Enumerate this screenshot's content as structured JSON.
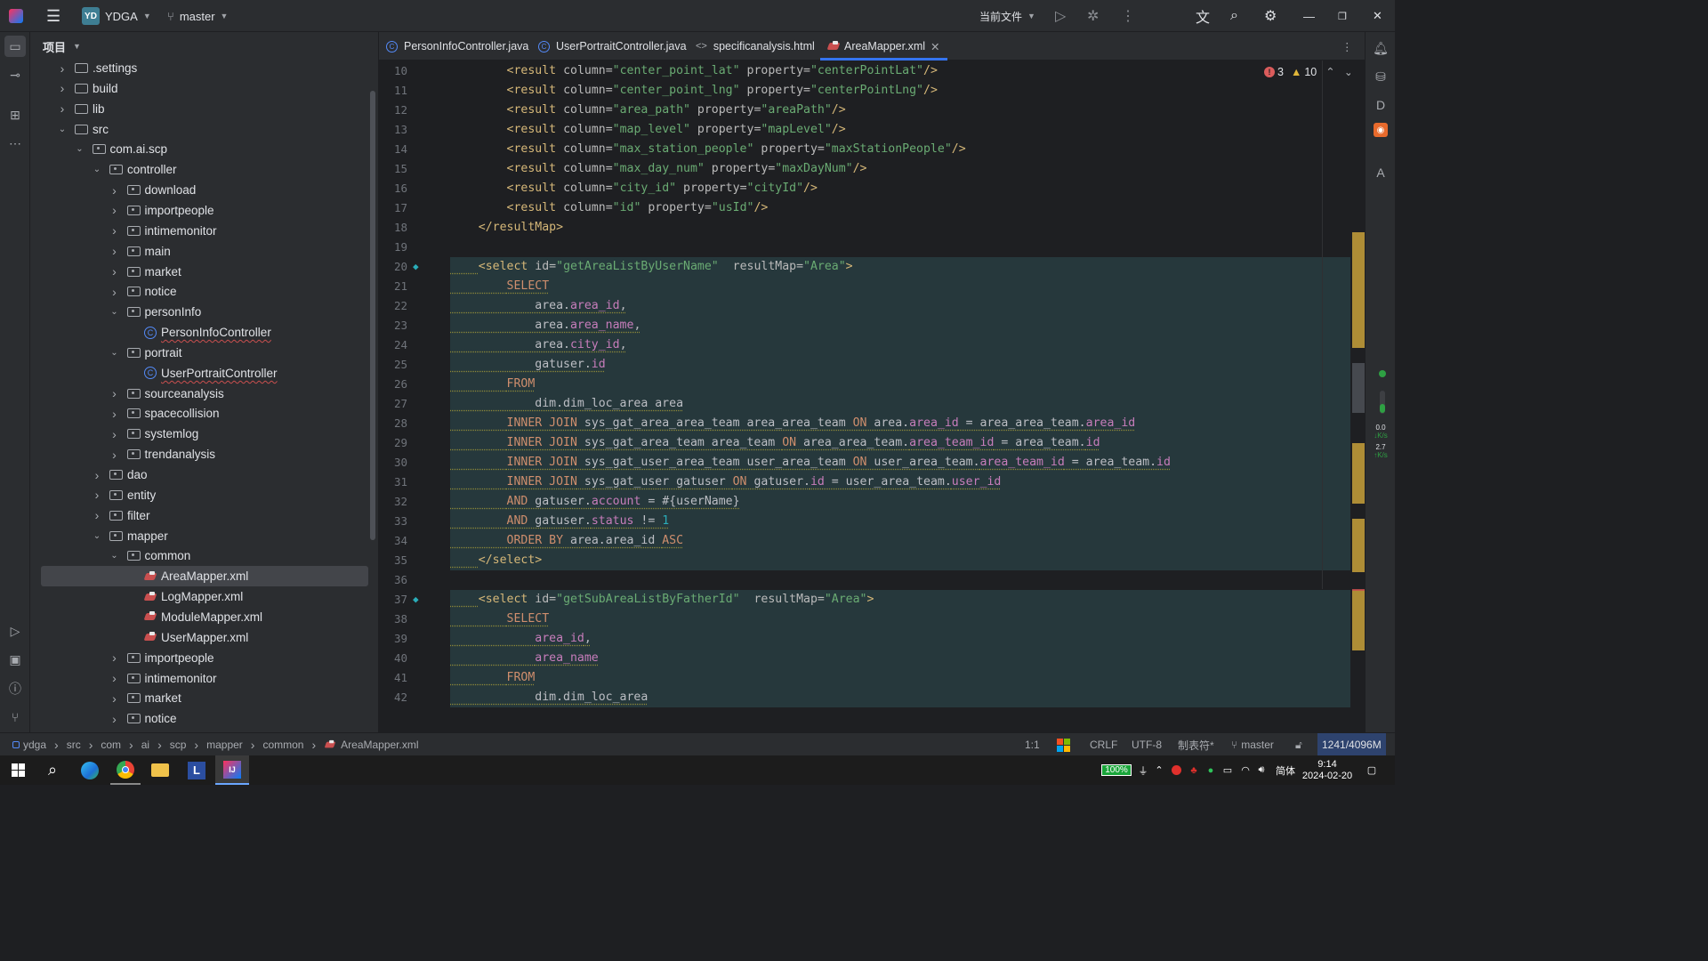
{
  "titlebar": {
    "project_badge": "YD",
    "project_name": "YDGA",
    "branch": "master",
    "run_config": "当前文件"
  },
  "sidebar": {
    "title": "项目",
    "tree": [
      {
        "label": ".settings",
        "type": "folder",
        "depth": 1,
        "expanded": false
      },
      {
        "label": "build",
        "type": "folder",
        "depth": 1,
        "expanded": false
      },
      {
        "label": "lib",
        "type": "folder",
        "depth": 1,
        "expanded": false
      },
      {
        "label": "src",
        "type": "folder",
        "depth": 1,
        "expanded": true
      },
      {
        "label": "com.ai.scp",
        "type": "package",
        "depth": 2,
        "expanded": true
      },
      {
        "label": "controller",
        "type": "package",
        "depth": 3,
        "expanded": true
      },
      {
        "label": "download",
        "type": "package",
        "depth": 4,
        "expanded": false
      },
      {
        "label": "importpeople",
        "type": "package",
        "depth": 4,
        "expanded": false
      },
      {
        "label": "intimemonitor",
        "type": "package",
        "depth": 4,
        "expanded": false
      },
      {
        "label": "main",
        "type": "package",
        "depth": 4,
        "expanded": false
      },
      {
        "label": "market",
        "type": "package",
        "depth": 4,
        "expanded": false
      },
      {
        "label": "notice",
        "type": "package",
        "depth": 4,
        "expanded": false
      },
      {
        "label": "personInfo",
        "type": "package",
        "depth": 4,
        "expanded": true
      },
      {
        "label": "PersonInfoController",
        "type": "class",
        "depth": 5,
        "expanded": null
      },
      {
        "label": "portrait",
        "type": "package",
        "depth": 4,
        "expanded": true
      },
      {
        "label": "UserPortraitController",
        "type": "class",
        "depth": 5,
        "expanded": null
      },
      {
        "label": "sourceanalysis",
        "type": "package",
        "depth": 4,
        "expanded": false
      },
      {
        "label": "spacecollision",
        "type": "package",
        "depth": 4,
        "expanded": false
      },
      {
        "label": "systemlog",
        "type": "package",
        "depth": 4,
        "expanded": false
      },
      {
        "label": "trendanalysis",
        "type": "package",
        "depth": 4,
        "expanded": false
      },
      {
        "label": "dao",
        "type": "package",
        "depth": 3,
        "expanded": false
      },
      {
        "label": "entity",
        "type": "package",
        "depth": 3,
        "expanded": false
      },
      {
        "label": "filter",
        "type": "package",
        "depth": 3,
        "expanded": false
      },
      {
        "label": "mapper",
        "type": "package",
        "depth": 3,
        "expanded": true
      },
      {
        "label": "common",
        "type": "package",
        "depth": 4,
        "expanded": true
      },
      {
        "label": "AreaMapper.xml",
        "type": "xml",
        "depth": 5,
        "expanded": null,
        "selected": true
      },
      {
        "label": "LogMapper.xml",
        "type": "xml",
        "depth": 5,
        "expanded": null
      },
      {
        "label": "ModuleMapper.xml",
        "type": "xml",
        "depth": 5,
        "expanded": null
      },
      {
        "label": "UserMapper.xml",
        "type": "xml",
        "depth": 5,
        "expanded": null
      },
      {
        "label": "importpeople",
        "type": "package",
        "depth": 4,
        "expanded": false
      },
      {
        "label": "intimemonitor",
        "type": "package",
        "depth": 4,
        "expanded": false
      },
      {
        "label": "market",
        "type": "package",
        "depth": 4,
        "expanded": false
      },
      {
        "label": "notice",
        "type": "package",
        "depth": 4,
        "expanded": false
      }
    ]
  },
  "tabs": [
    {
      "label": "PersonInfoController.java",
      "icon": "class-icon"
    },
    {
      "label": "UserPortraitController.java",
      "icon": "class-icon"
    },
    {
      "label": "specificanalysis.html",
      "icon": "html-icon"
    },
    {
      "label": "AreaMapper.xml",
      "icon": "xml-icon",
      "active": true
    }
  ],
  "inspections": {
    "errors": "3",
    "warnings": "10"
  },
  "editor": {
    "lines": [
      {
        "n": "10",
        "tokens": [
          [
            "p",
            "        "
          ],
          [
            "t",
            "<result "
          ],
          [
            "a",
            "column="
          ],
          [
            "s",
            "\"center_point_lat\""
          ],
          [
            "a",
            " property="
          ],
          [
            "s",
            "\"centerPointLat\""
          ],
          [
            "t",
            "/>"
          ]
        ]
      },
      {
        "n": "11",
        "tokens": [
          [
            "p",
            "        "
          ],
          [
            "t",
            "<result "
          ],
          [
            "a",
            "column="
          ],
          [
            "s",
            "\"center_point_lng\""
          ],
          [
            "a",
            " property="
          ],
          [
            "s",
            "\"centerPointLng\""
          ],
          [
            "t",
            "/>"
          ]
        ]
      },
      {
        "n": "12",
        "tokens": [
          [
            "p",
            "        "
          ],
          [
            "t",
            "<result "
          ],
          [
            "a",
            "column="
          ],
          [
            "s",
            "\"area_path\""
          ],
          [
            "a",
            " property="
          ],
          [
            "s",
            "\"areaPath\""
          ],
          [
            "t",
            "/>"
          ]
        ]
      },
      {
        "n": "13",
        "tokens": [
          [
            "p",
            "        "
          ],
          [
            "t",
            "<result "
          ],
          [
            "a",
            "column="
          ],
          [
            "s",
            "\"map_level\""
          ],
          [
            "a",
            " property="
          ],
          [
            "s",
            "\"mapLevel\""
          ],
          [
            "t",
            "/>"
          ]
        ]
      },
      {
        "n": "14",
        "tokens": [
          [
            "p",
            "        "
          ],
          [
            "t",
            "<result "
          ],
          [
            "a",
            "column="
          ],
          [
            "s",
            "\"max_station_people\""
          ],
          [
            "a",
            " property="
          ],
          [
            "s",
            "\"maxStationPeople\""
          ],
          [
            "t",
            "/>"
          ]
        ]
      },
      {
        "n": "15",
        "tokens": [
          [
            "p",
            "        "
          ],
          [
            "t",
            "<result "
          ],
          [
            "a",
            "column="
          ],
          [
            "s",
            "\"max_day_num\""
          ],
          [
            "a",
            " property="
          ],
          [
            "s",
            "\"maxDayNum\""
          ],
          [
            "t",
            "/>"
          ]
        ]
      },
      {
        "n": "16",
        "tokens": [
          [
            "p",
            "        "
          ],
          [
            "t",
            "<result "
          ],
          [
            "a",
            "column="
          ],
          [
            "s",
            "\"city_id\""
          ],
          [
            "a",
            " property="
          ],
          [
            "s",
            "\"cityId\""
          ],
          [
            "t",
            "/>"
          ]
        ]
      },
      {
        "n": "17",
        "tokens": [
          [
            "p",
            "        "
          ],
          [
            "t",
            "<result "
          ],
          [
            "a",
            "column="
          ],
          [
            "s",
            "\"id\""
          ],
          [
            "a",
            " property="
          ],
          [
            "s",
            "\"usId\""
          ],
          [
            "t",
            "/>"
          ]
        ]
      },
      {
        "n": "18",
        "tokens": [
          [
            "p",
            "    "
          ],
          [
            "t",
            "</resultMap>"
          ]
        ]
      },
      {
        "n": "19",
        "tokens": []
      },
      {
        "n": "20",
        "hl": true,
        "tokens": [
          [
            "p",
            "    "
          ],
          [
            "t",
            "<select "
          ],
          [
            "a",
            "id="
          ],
          [
            "s",
            "\"getAreaListByUserName\""
          ],
          [
            "a",
            "  resultMap="
          ],
          [
            "s",
            "\"Area\""
          ],
          [
            "t",
            ">"
          ]
        ]
      },
      {
        "n": "21",
        "hl": true,
        "tokens": [
          [
            "p",
            "        "
          ],
          [
            "k",
            "SELECT"
          ]
        ]
      },
      {
        "n": "22",
        "hl": true,
        "tokens": [
          [
            "p",
            "            area."
          ],
          [
            "f",
            "area_id"
          ],
          [
            "p",
            ","
          ]
        ]
      },
      {
        "n": "23",
        "hl": true,
        "tokens": [
          [
            "p",
            "            area."
          ],
          [
            "f",
            "area_name"
          ],
          [
            "p",
            ","
          ]
        ]
      },
      {
        "n": "24",
        "hl": true,
        "tokens": [
          [
            "p",
            "            area."
          ],
          [
            "f",
            "city_id"
          ],
          [
            "p",
            ","
          ]
        ]
      },
      {
        "n": "25",
        "hl": true,
        "tokens": [
          [
            "p",
            "            gatuser."
          ],
          [
            "f",
            "id"
          ]
        ]
      },
      {
        "n": "26",
        "hl": true,
        "tokens": [
          [
            "p",
            "        "
          ],
          [
            "k",
            "FROM"
          ]
        ]
      },
      {
        "n": "27",
        "hl": true,
        "tokens": [
          [
            "p",
            "            dim.dim_loc_area area"
          ]
        ]
      },
      {
        "n": "28",
        "hl": true,
        "tokens": [
          [
            "p",
            "        "
          ],
          [
            "k",
            "INNER JOIN"
          ],
          [
            "p",
            " sys_gat_area_area_team area_area_team "
          ],
          [
            "k",
            "ON"
          ],
          [
            "p",
            " area."
          ],
          [
            "f",
            "area_id"
          ],
          [
            "p",
            " = area_area_team."
          ],
          [
            "f",
            "area_id"
          ]
        ]
      },
      {
        "n": "29",
        "hl": true,
        "tokens": [
          [
            "p",
            "        "
          ],
          [
            "k",
            "INNER JOIN"
          ],
          [
            "p",
            " sys_gat_area_team area_team "
          ],
          [
            "k",
            "ON"
          ],
          [
            "p",
            " area_area_team."
          ],
          [
            "f",
            "area_team_id"
          ],
          [
            "p",
            " = area_team."
          ],
          [
            "f",
            "id"
          ]
        ]
      },
      {
        "n": "30",
        "hl": true,
        "tokens": [
          [
            "p",
            "        "
          ],
          [
            "k",
            "INNER JOIN"
          ],
          [
            "p",
            " sys_gat_user_area_team user_area_team "
          ],
          [
            "k",
            "ON"
          ],
          [
            "p",
            " user_area_team."
          ],
          [
            "f",
            "area_team_id"
          ],
          [
            "p",
            " = area_team."
          ],
          [
            "f",
            "id"
          ]
        ]
      },
      {
        "n": "31",
        "hl": true,
        "tokens": [
          [
            "p",
            "        "
          ],
          [
            "k",
            "INNER JOIN"
          ],
          [
            "p",
            " sys_gat_user gatuser "
          ],
          [
            "k",
            "ON"
          ],
          [
            "p",
            " gatuser."
          ],
          [
            "f",
            "id"
          ],
          [
            "p",
            " = user_area_team."
          ],
          [
            "f",
            "user_id"
          ]
        ]
      },
      {
        "n": "32",
        "hl": true,
        "tokens": [
          [
            "p",
            "        "
          ],
          [
            "k",
            "AND"
          ],
          [
            "p",
            " gatuser."
          ],
          [
            "f",
            "account"
          ],
          [
            "p",
            " = #{userName}"
          ]
        ]
      },
      {
        "n": "33",
        "hl": true,
        "tokens": [
          [
            "p",
            "        "
          ],
          [
            "k",
            "AND"
          ],
          [
            "p",
            " gatuser."
          ],
          [
            "f",
            "status"
          ],
          [
            "p",
            " != "
          ],
          [
            "n",
            "1"
          ]
        ]
      },
      {
        "n": "34",
        "hl": true,
        "tokens": [
          [
            "p",
            "        "
          ],
          [
            "k",
            "ORDER BY"
          ],
          [
            "p",
            " area.area_id "
          ],
          [
            "k",
            "ASC"
          ]
        ]
      },
      {
        "n": "35",
        "hl": true,
        "tokens": [
          [
            "p",
            "    "
          ],
          [
            "t",
            "</select>"
          ]
        ]
      },
      {
        "n": "36",
        "tokens": []
      },
      {
        "n": "37",
        "hl": true,
        "tokens": [
          [
            "p",
            "    "
          ],
          [
            "t",
            "<select "
          ],
          [
            "a",
            "id="
          ],
          [
            "s",
            "\"getSubAreaListByFatherId\""
          ],
          [
            "a",
            "  resultMap="
          ],
          [
            "s",
            "\"Area\""
          ],
          [
            "t",
            ">"
          ]
        ]
      },
      {
        "n": "38",
        "hl": true,
        "tokens": [
          [
            "p",
            "        "
          ],
          [
            "k",
            "SELECT"
          ]
        ]
      },
      {
        "n": "39",
        "hl": true,
        "tokens": [
          [
            "p",
            "            "
          ],
          [
            "f",
            "area_id"
          ],
          [
            "p",
            ","
          ]
        ]
      },
      {
        "n": "40",
        "hl": true,
        "tokens": [
          [
            "p",
            "            "
          ],
          [
            "f",
            "area_name"
          ]
        ]
      },
      {
        "n": "41",
        "hl": true,
        "tokens": [
          [
            "p",
            "        "
          ],
          [
            "k",
            "FROM"
          ]
        ]
      },
      {
        "n": "42",
        "hl": true,
        "tokens": [
          [
            "p",
            "            dim.dim_loc_area"
          ]
        ]
      }
    ]
  },
  "breadcrumb": [
    "ydga",
    "src",
    "com",
    "ai",
    "scp",
    "mapper",
    "common",
    "AreaMapper.xml"
  ],
  "status": {
    "position": "1:1",
    "line_sep": "CRLF",
    "encoding": "UTF-8",
    "indent": "制表符*",
    "branch": "master",
    "memory": "1241/4096M"
  },
  "netspeed": {
    "down": "0.0",
    "up": "2.7",
    "unit": "K/s"
  },
  "taskbar": {
    "battery": "100%",
    "ime": "简体",
    "time": "9:14",
    "date": "2024-02-20"
  }
}
